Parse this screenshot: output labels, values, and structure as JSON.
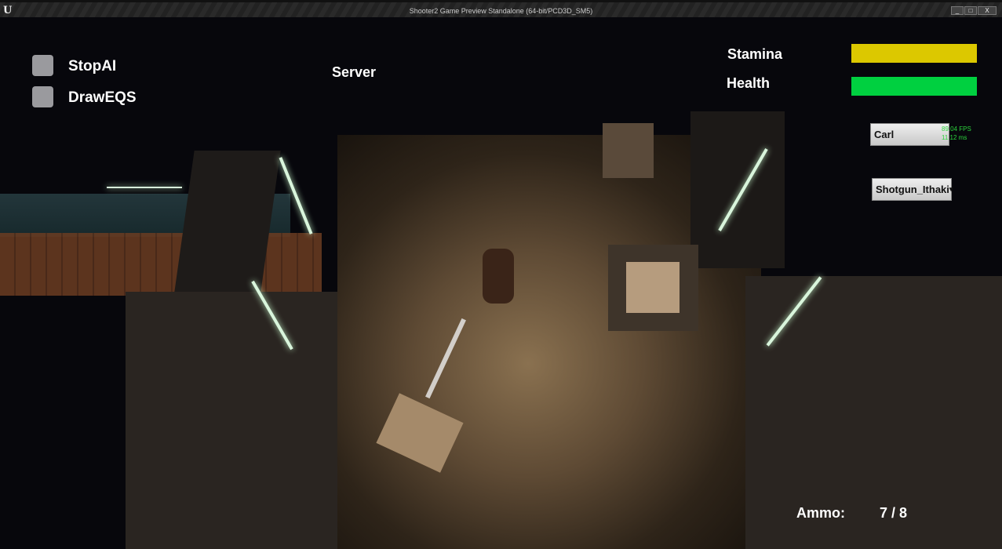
{
  "window": {
    "title": "Shooter2 Game Preview Standalone (64-bit/PCD3D_SM5)",
    "logo": "U",
    "minimize": "_",
    "maximize": "□",
    "close": "X"
  },
  "hud": {
    "checkboxes": [
      {
        "label": "StopAI",
        "checked": false
      },
      {
        "label": "DrawEQS",
        "checked": false
      }
    ],
    "role": "Server",
    "stamina": {
      "label": "Stamina",
      "value": 1.0,
      "color": "#dcc800"
    },
    "health": {
      "label": "Health",
      "value": 1.0,
      "color": "#00d040"
    },
    "character_button": "Carl",
    "weapon_dropdown": "Shotgun_Ithaki",
    "dropdown_arrow": "▾",
    "fps": "89.04 FPS",
    "frame_time": "11.12 ms",
    "ammo_label": "Ammo:",
    "ammo_value": "7 / 8"
  }
}
